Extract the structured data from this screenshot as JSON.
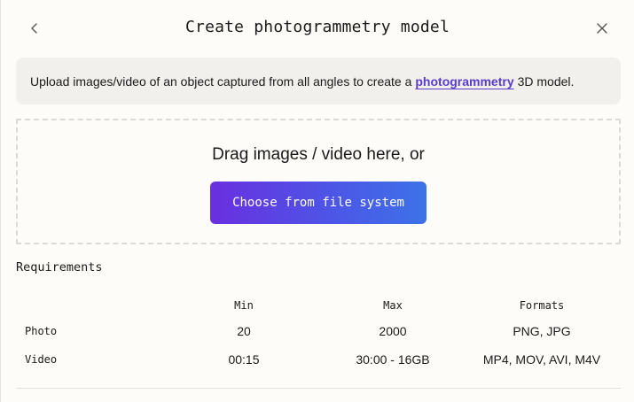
{
  "dialog": {
    "title": "Create photogrammetry model"
  },
  "info": {
    "text_before": "Upload images/video of an object captured from all angles to create a",
    "link_text": "photogrammetry",
    "text_after": "3D model."
  },
  "dropzone": {
    "prompt": "Drag images / video here, or",
    "button_label": "Choose from file system"
  },
  "requirements": {
    "title": "Requirements",
    "columns": [
      "Min",
      "Max",
      "Formats"
    ],
    "rows": [
      {
        "label": "Photo",
        "min": "20",
        "max": "2000",
        "formats": "PNG, JPG"
      },
      {
        "label": "Video",
        "min": "00:15",
        "max": "30:00 - 16GB",
        "formats": "MP4, MOV, AVI, M4V"
      }
    ]
  },
  "icons": {
    "back": "chevron-left-icon",
    "close": "close-icon"
  },
  "colors": {
    "link": "#5b3bc9",
    "button_gradient_start": "#6a2fe0",
    "button_gradient_end": "#3d72e8",
    "background": "#fdfcf8",
    "info_background": "#f1f0ec"
  }
}
